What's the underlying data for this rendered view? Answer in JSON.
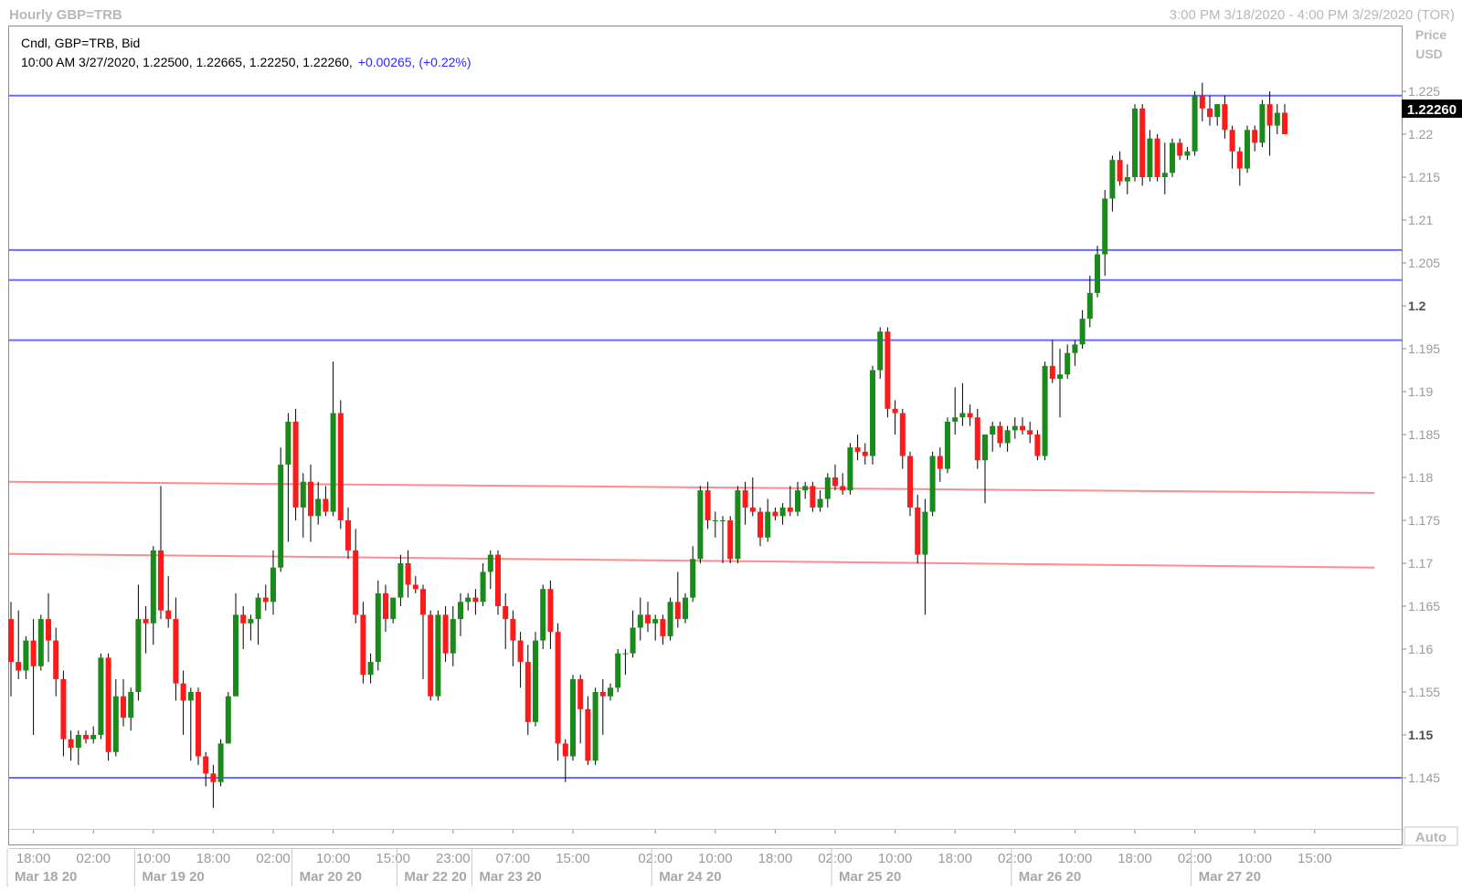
{
  "header": {
    "title": "Hourly GBP=TRB",
    "range": "3:00 PM 3/18/2020 - 4:00 PM 3/29/2020 (TOR)"
  },
  "legend": {
    "line1": "Cndl, GBP=TRB, Bid",
    "line2_prefix": "10:00 AM 3/27/2020, 1.22500, 1.22665, 1.22250, 1.22260,",
    "line2_change": "+0.00265, (+0.22%)"
  },
  "axis": {
    "price_label": "Price",
    "currency_label": "USD",
    "last_price": "1.22260",
    "auto_label": "Auto",
    "bold_ticks": [
      "1.2",
      "1.15"
    ]
  },
  "colors": {
    "up": "#1a8a1a",
    "down": "#ff1a1a",
    "support": "#6b6bff",
    "trend": "#ff8c8c",
    "change_text": "#2a2aff"
  },
  "chart_data": {
    "type": "candlestick",
    "title": "Hourly GBP=TRB",
    "ylabel": "Price USD",
    "ylim": [
      1.14,
      1.231
    ],
    "y_ticks": [
      1.145,
      1.15,
      1.155,
      1.16,
      1.165,
      1.17,
      1.175,
      1.18,
      1.185,
      1.19,
      1.195,
      1.2,
      1.205,
      1.21,
      1.215,
      1.22,
      1.225
    ],
    "y_tick_labels": [
      "1.145",
      "1.15",
      "1.155",
      "1.16",
      "1.165",
      "1.17",
      "1.175",
      "1.18",
      "1.185",
      "1.19",
      "1.195",
      "1.2",
      "1.205",
      "1.21",
      "1.215",
      "1.22",
      "1.225"
    ],
    "time_ticks": [
      {
        "bar": 3,
        "label": "18:00"
      },
      {
        "bar": 11,
        "label": "02:00"
      },
      {
        "bar": 19,
        "label": "10:00"
      },
      {
        "bar": 27,
        "label": "18:00"
      },
      {
        "bar": 35,
        "label": "02:00"
      },
      {
        "bar": 43,
        "label": "10:00"
      },
      {
        "bar": 51,
        "label": "15:00"
      },
      {
        "bar": 59,
        "label": "23:00"
      },
      {
        "bar": 67,
        "label": "07:00"
      },
      {
        "bar": 75,
        "label": "15:00"
      },
      {
        "bar": 86,
        "label": "02:00"
      },
      {
        "bar": 94,
        "label": "10:00"
      },
      {
        "bar": 102,
        "label": "18:00"
      },
      {
        "bar": 110,
        "label": "02:00"
      },
      {
        "bar": 118,
        "label": "10:00"
      },
      {
        "bar": 126,
        "label": "18:00"
      },
      {
        "bar": 134,
        "label": "02:00"
      },
      {
        "bar": 142,
        "label": "10:00"
      },
      {
        "bar": 150,
        "label": "18:00"
      },
      {
        "bar": 158,
        "label": "02:00"
      },
      {
        "bar": 166,
        "label": "10:00"
      },
      {
        "bar": 174,
        "label": "15:00"
      }
    ],
    "date_ticks": [
      {
        "bar": 0,
        "label": "Mar 18 20"
      },
      {
        "bar": 17,
        "label": "Mar 19 20"
      },
      {
        "bar": 38,
        "label": "Mar 20 20"
      },
      {
        "bar": 52,
        "label": "Mar 22 20"
      },
      {
        "bar": 62,
        "label": "Mar 23 20"
      },
      {
        "bar": 86,
        "label": "Mar 24 20"
      },
      {
        "bar": 110,
        "label": "Mar 25 20"
      },
      {
        "bar": 134,
        "label": "Mar 26 20"
      },
      {
        "bar": 158,
        "label": "Mar 27 20"
      }
    ],
    "horizontal_lines": [
      1.2245,
      1.2065,
      1.203,
      1.196,
      1.145
    ],
    "trend_lines": [
      {
        "from": [
          0,
          1.1795
        ],
        "to": [
          182,
          1.1782
        ]
      },
      {
        "from": [
          0,
          1.1711
        ],
        "to": [
          182,
          1.1695
        ]
      }
    ],
    "candles": [
      [
        1.1635,
        1.1655,
        1.1545,
        1.1585
      ],
      [
        1.1585,
        1.1645,
        1.1565,
        1.1575
      ],
      [
        1.1575,
        1.1615,
        1.1565,
        1.161
      ],
      [
        1.161,
        1.1635,
        1.15,
        1.158
      ],
      [
        1.158,
        1.164,
        1.1575,
        1.1635
      ],
      [
        1.1635,
        1.1665,
        1.1585,
        1.161
      ],
      [
        1.161,
        1.1625,
        1.1545,
        1.1565
      ],
      [
        1.1565,
        1.1575,
        1.1475,
        1.1495
      ],
      [
        1.1495,
        1.1505,
        1.147,
        1.1485
      ],
      [
        1.1485,
        1.1505,
        1.1465,
        1.15
      ],
      [
        1.15,
        1.1505,
        1.149,
        1.1495
      ],
      [
        1.1495,
        1.151,
        1.149,
        1.15
      ],
      [
        1.15,
        1.1595,
        1.1495,
        1.159
      ],
      [
        1.159,
        1.1595,
        1.147,
        1.148
      ],
      [
        1.148,
        1.1565,
        1.1475,
        1.1545
      ],
      [
        1.1545,
        1.1565,
        1.151,
        1.152
      ],
      [
        1.152,
        1.1555,
        1.1505,
        1.155
      ],
      [
        1.155,
        1.1675,
        1.154,
        1.1635
      ],
      [
        1.1635,
        1.165,
        1.1595,
        1.163
      ],
      [
        1.163,
        1.172,
        1.1605,
        1.1715
      ],
      [
        1.1715,
        1.179,
        1.1635,
        1.1645
      ],
      [
        1.1645,
        1.1685,
        1.1625,
        1.1635
      ],
      [
        1.1635,
        1.166,
        1.154,
        1.156
      ],
      [
        1.156,
        1.1575,
        1.15,
        1.154
      ],
      [
        1.154,
        1.1555,
        1.147,
        1.155
      ],
      [
        1.155,
        1.1555,
        1.1465,
        1.1475
      ],
      [
        1.1475,
        1.148,
        1.144,
        1.1455
      ],
      [
        1.1455,
        1.1465,
        1.1415,
        1.1445
      ],
      [
        1.1445,
        1.1495,
        1.144,
        1.149
      ],
      [
        1.149,
        1.155,
        1.149,
        1.1545
      ],
      [
        1.1545,
        1.1665,
        1.1545,
        1.164
      ],
      [
        1.164,
        1.165,
        1.16,
        1.163
      ],
      [
        1.163,
        1.164,
        1.161,
        1.1635
      ],
      [
        1.1635,
        1.1665,
        1.1605,
        1.166
      ],
      [
        1.166,
        1.1675,
        1.1645,
        1.1655
      ],
      [
        1.1655,
        1.1715,
        1.164,
        1.1695
      ],
      [
        1.1695,
        1.1835,
        1.169,
        1.1815
      ],
      [
        1.1815,
        1.1875,
        1.1725,
        1.1865
      ],
      [
        1.1865,
        1.188,
        1.175,
        1.1765
      ],
      [
        1.1765,
        1.1805,
        1.173,
        1.1795
      ],
      [
        1.1795,
        1.1815,
        1.1725,
        1.1755
      ],
      [
        1.1755,
        1.1795,
        1.1745,
        1.1775
      ],
      [
        1.1775,
        1.179,
        1.1755,
        1.176
      ],
      [
        1.176,
        1.1935,
        1.1755,
        1.1875
      ],
      [
        1.1875,
        1.189,
        1.174,
        1.175
      ],
      [
        1.175,
        1.1765,
        1.1705,
        1.1715
      ],
      [
        1.1715,
        1.174,
        1.163,
        1.164
      ],
      [
        1.164,
        1.1655,
        1.156,
        1.157
      ],
      [
        1.157,
        1.1595,
        1.156,
        1.1585
      ],
      [
        1.1585,
        1.168,
        1.1575,
        1.1665
      ],
      [
        1.1665,
        1.1675,
        1.162,
        1.1635
      ],
      [
        1.1635,
        1.166,
        1.163,
        1.166
      ],
      [
        1.166,
        1.171,
        1.165,
        1.17
      ],
      [
        1.17,
        1.1715,
        1.166,
        1.1675
      ],
      [
        1.1675,
        1.1685,
        1.1665,
        1.167
      ],
      [
        1.167,
        1.1675,
        1.1565,
        1.164
      ],
      [
        1.164,
        1.1645,
        1.154,
        1.1545
      ],
      [
        1.1545,
        1.1645,
        1.154,
        1.164
      ],
      [
        1.164,
        1.165,
        1.1585,
        1.1595
      ],
      [
        1.1595,
        1.165,
        1.158,
        1.1635
      ],
      [
        1.1635,
        1.1665,
        1.1615,
        1.1655
      ],
      [
        1.1655,
        1.1665,
        1.1645,
        1.166
      ],
      [
        1.166,
        1.167,
        1.164,
        1.1655
      ],
      [
        1.1655,
        1.17,
        1.165,
        1.169
      ],
      [
        1.169,
        1.1715,
        1.167,
        1.171
      ],
      [
        1.171,
        1.1715,
        1.164,
        1.165
      ],
      [
        1.165,
        1.1665,
        1.16,
        1.1635
      ],
      [
        1.1635,
        1.1645,
        1.158,
        1.161
      ],
      [
        1.161,
        1.162,
        1.1555,
        1.1585
      ],
      [
        1.1585,
        1.1605,
        1.15,
        1.1515
      ],
      [
        1.1515,
        1.162,
        1.151,
        1.161
      ],
      [
        1.161,
        1.1675,
        1.16,
        1.167
      ],
      [
        1.167,
        1.168,
        1.16,
        1.162
      ],
      [
        1.162,
        1.163,
        1.147,
        1.149
      ],
      [
        1.149,
        1.1495,
        1.1445,
        1.1475
      ],
      [
        1.1475,
        1.157,
        1.147,
        1.1565
      ],
      [
        1.1565,
        1.157,
        1.149,
        1.153
      ],
      [
        1.153,
        1.1545,
        1.1465,
        1.147
      ],
      [
        1.147,
        1.1555,
        1.1465,
        1.155
      ],
      [
        1.155,
        1.1565,
        1.15,
        1.1545
      ],
      [
        1.1545,
        1.156,
        1.154,
        1.1555
      ],
      [
        1.1555,
        1.16,
        1.155,
        1.1595
      ],
      [
        1.1595,
        1.16,
        1.157,
        1.1595
      ],
      [
        1.1595,
        1.1645,
        1.159,
        1.1625
      ],
      [
        1.1625,
        1.166,
        1.161,
        1.164
      ],
      [
        1.164,
        1.1655,
        1.162,
        1.163
      ],
      [
        1.163,
        1.164,
        1.161,
        1.1635
      ],
      [
        1.1635,
        1.164,
        1.1605,
        1.1615
      ],
      [
        1.1615,
        1.166,
        1.161,
        1.1655
      ],
      [
        1.1655,
        1.169,
        1.1625,
        1.1635
      ],
      [
        1.1635,
        1.1665,
        1.163,
        1.166
      ],
      [
        1.166,
        1.172,
        1.1655,
        1.1705
      ],
      [
        1.1705,
        1.179,
        1.17,
        1.1785
      ],
      [
        1.1785,
        1.1795,
        1.174,
        1.175
      ],
      [
        1.175,
        1.176,
        1.173,
        1.175
      ],
      [
        1.175,
        1.1755,
        1.17,
        1.175
      ],
      [
        1.175,
        1.1755,
        1.17,
        1.1705
      ],
      [
        1.1705,
        1.179,
        1.17,
        1.1785
      ],
      [
        1.1785,
        1.1795,
        1.1745,
        1.1765
      ],
      [
        1.1765,
        1.18,
        1.1755,
        1.176
      ],
      [
        1.176,
        1.1765,
        1.172,
        1.173
      ],
      [
        1.173,
        1.1775,
        1.1725,
        1.176
      ],
      [
        1.176,
        1.1765,
        1.175,
        1.1755
      ],
      [
        1.1755,
        1.177,
        1.1745,
        1.1765
      ],
      [
        1.1765,
        1.179,
        1.1755,
        1.176
      ],
      [
        1.176,
        1.1795,
        1.1755,
        1.1785
      ],
      [
        1.1785,
        1.1795,
        1.1775,
        1.179
      ],
      [
        1.179,
        1.1795,
        1.176,
        1.1765
      ],
      [
        1.1765,
        1.1785,
        1.176,
        1.1775
      ],
      [
        1.1775,
        1.1805,
        1.1765,
        1.18
      ],
      [
        1.18,
        1.1815,
        1.1785,
        1.179
      ],
      [
        1.179,
        1.1805,
        1.178,
        1.1785
      ],
      [
        1.1785,
        1.184,
        1.178,
        1.1835
      ],
      [
        1.1835,
        1.185,
        1.182,
        1.183
      ],
      [
        1.183,
        1.184,
        1.1815,
        1.1825
      ],
      [
        1.1825,
        1.193,
        1.1815,
        1.1925
      ],
      [
        1.1925,
        1.1975,
        1.1915,
        1.197
      ],
      [
        1.197,
        1.1975,
        1.187,
        1.188
      ],
      [
        1.188,
        1.189,
        1.185,
        1.1875
      ],
      [
        1.1875,
        1.188,
        1.181,
        1.1825
      ],
      [
        1.1825,
        1.183,
        1.1755,
        1.1765
      ],
      [
        1.1765,
        1.178,
        1.17,
        1.171
      ],
      [
        1.171,
        1.1775,
        1.164,
        1.176
      ],
      [
        1.176,
        1.183,
        1.1755,
        1.1825
      ],
      [
        1.1825,
        1.1835,
        1.1795,
        1.181
      ],
      [
        1.181,
        1.187,
        1.1805,
        1.1865
      ],
      [
        1.1865,
        1.1905,
        1.185,
        1.187
      ],
      [
        1.187,
        1.191,
        1.186,
        1.1875
      ],
      [
        1.1875,
        1.1885,
        1.186,
        1.187
      ],
      [
        1.187,
        1.188,
        1.181,
        1.182
      ],
      [
        1.182,
        1.1835,
        1.177,
        1.185
      ],
      [
        1.185,
        1.1865,
        1.183,
        1.186
      ],
      [
        1.186,
        1.1865,
        1.1835,
        1.184
      ],
      [
        1.184,
        1.186,
        1.183,
        1.1855
      ],
      [
        1.1855,
        1.187,
        1.1845,
        1.186
      ],
      [
        1.186,
        1.187,
        1.185,
        1.1855
      ],
      [
        1.1855,
        1.1865,
        1.184,
        1.185
      ],
      [
        1.185,
        1.1855,
        1.182,
        1.1825
      ],
      [
        1.1825,
        1.1935,
        1.182,
        1.193
      ],
      [
        1.193,
        1.196,
        1.191,
        1.1915
      ],
      [
        1.1915,
        1.195,
        1.187,
        1.192
      ],
      [
        1.192,
        1.1955,
        1.1915,
        1.1945
      ],
      [
        1.1945,
        1.196,
        1.193,
        1.1955
      ],
      [
        1.1955,
        1.1995,
        1.195,
        1.1985
      ],
      [
        1.1985,
        1.2035,
        1.1975,
        1.2015
      ],
      [
        1.2015,
        1.207,
        1.201,
        1.206
      ],
      [
        1.206,
        1.2135,
        1.2035,
        1.2125
      ],
      [
        1.2125,
        1.2175,
        1.211,
        1.217
      ],
      [
        1.217,
        1.218,
        1.214,
        1.2145
      ],
      [
        1.2145,
        1.2165,
        1.213,
        1.215
      ],
      [
        1.215,
        1.2235,
        1.2145,
        1.223
      ],
      [
        1.223,
        1.2235,
        1.214,
        1.215
      ],
      [
        1.215,
        1.2205,
        1.2145,
        1.2195
      ],
      [
        1.2195,
        1.22,
        1.2145,
        1.215
      ],
      [
        1.215,
        1.219,
        1.213,
        1.2155
      ],
      [
        1.2155,
        1.2195,
        1.215,
        1.219
      ],
      [
        1.219,
        1.2195,
        1.217,
        1.2175
      ],
      [
        1.2175,
        1.2185,
        1.217,
        1.218
      ],
      [
        1.218,
        1.225,
        1.2175,
        1.2245
      ],
      [
        1.2245,
        1.226,
        1.2215,
        1.223
      ],
      [
        1.223,
        1.2245,
        1.221,
        1.222
      ],
      [
        1.222,
        1.2235,
        1.221,
        1.2235
      ],
      [
        1.2235,
        1.2245,
        1.2195,
        1.2205
      ],
      [
        1.2205,
        1.221,
        1.216,
        1.218
      ],
      [
        1.218,
        1.2185,
        1.214,
        1.216
      ],
      [
        1.216,
        1.221,
        1.2155,
        1.2205
      ],
      [
        1.2205,
        1.221,
        1.218,
        1.219
      ],
      [
        1.219,
        1.224,
        1.2185,
        1.2235
      ],
      [
        1.2235,
        1.225,
        1.2175,
        1.221
      ],
      [
        1.221,
        1.2235,
        1.22,
        1.2225
      ],
      [
        1.2225,
        1.2235,
        1.22,
        1.22
      ]
    ]
  }
}
